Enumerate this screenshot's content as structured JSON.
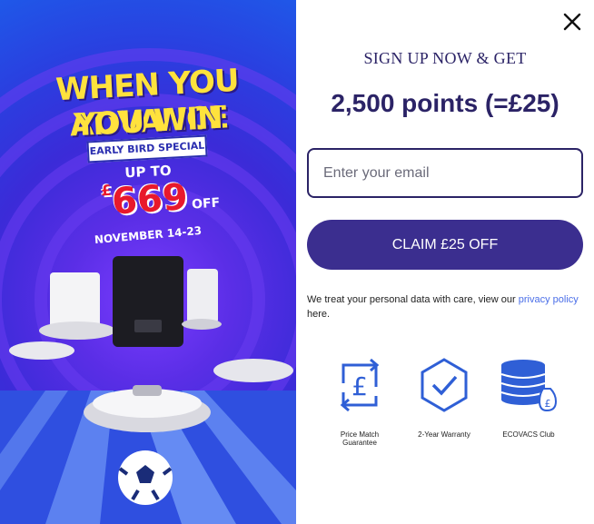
{
  "promo": {
    "headline_line1": "WHEN YOU ADVANCE",
    "headline_line2": "YOU WIN",
    "ribbon": "EARLY BIRD SPECIAL",
    "up_to": "UP TO",
    "currency": "£",
    "amount": "669",
    "off": "OFF",
    "dates": "NOVEMBER 14-23"
  },
  "signup": {
    "eyebrow": "SIGN UP NOW & GET",
    "points": "2,500 points (=£25)",
    "email_placeholder": "Enter your email",
    "email_value": "",
    "claim_label": "CLAIM £25 OFF",
    "privacy_prefix": "We treat your personal data with care, view our ",
    "privacy_link": "privacy policy",
    "privacy_suffix": "here."
  },
  "benefits": [
    {
      "icon": "pound-refresh-icon",
      "label": "Price Match Guarantee"
    },
    {
      "icon": "shield-check-icon",
      "label": "2-Year Warranty"
    },
    {
      "icon": "coin-stack-icon",
      "label": "ECOVACS Club"
    }
  ],
  "colors": {
    "brand_navy": "#2b2366",
    "button": "#3b2e8f",
    "link": "#4a6ee8",
    "icon_blue": "#2f5fd6",
    "headline_yellow": "#ffe23d",
    "price_red": "#e8192c"
  }
}
